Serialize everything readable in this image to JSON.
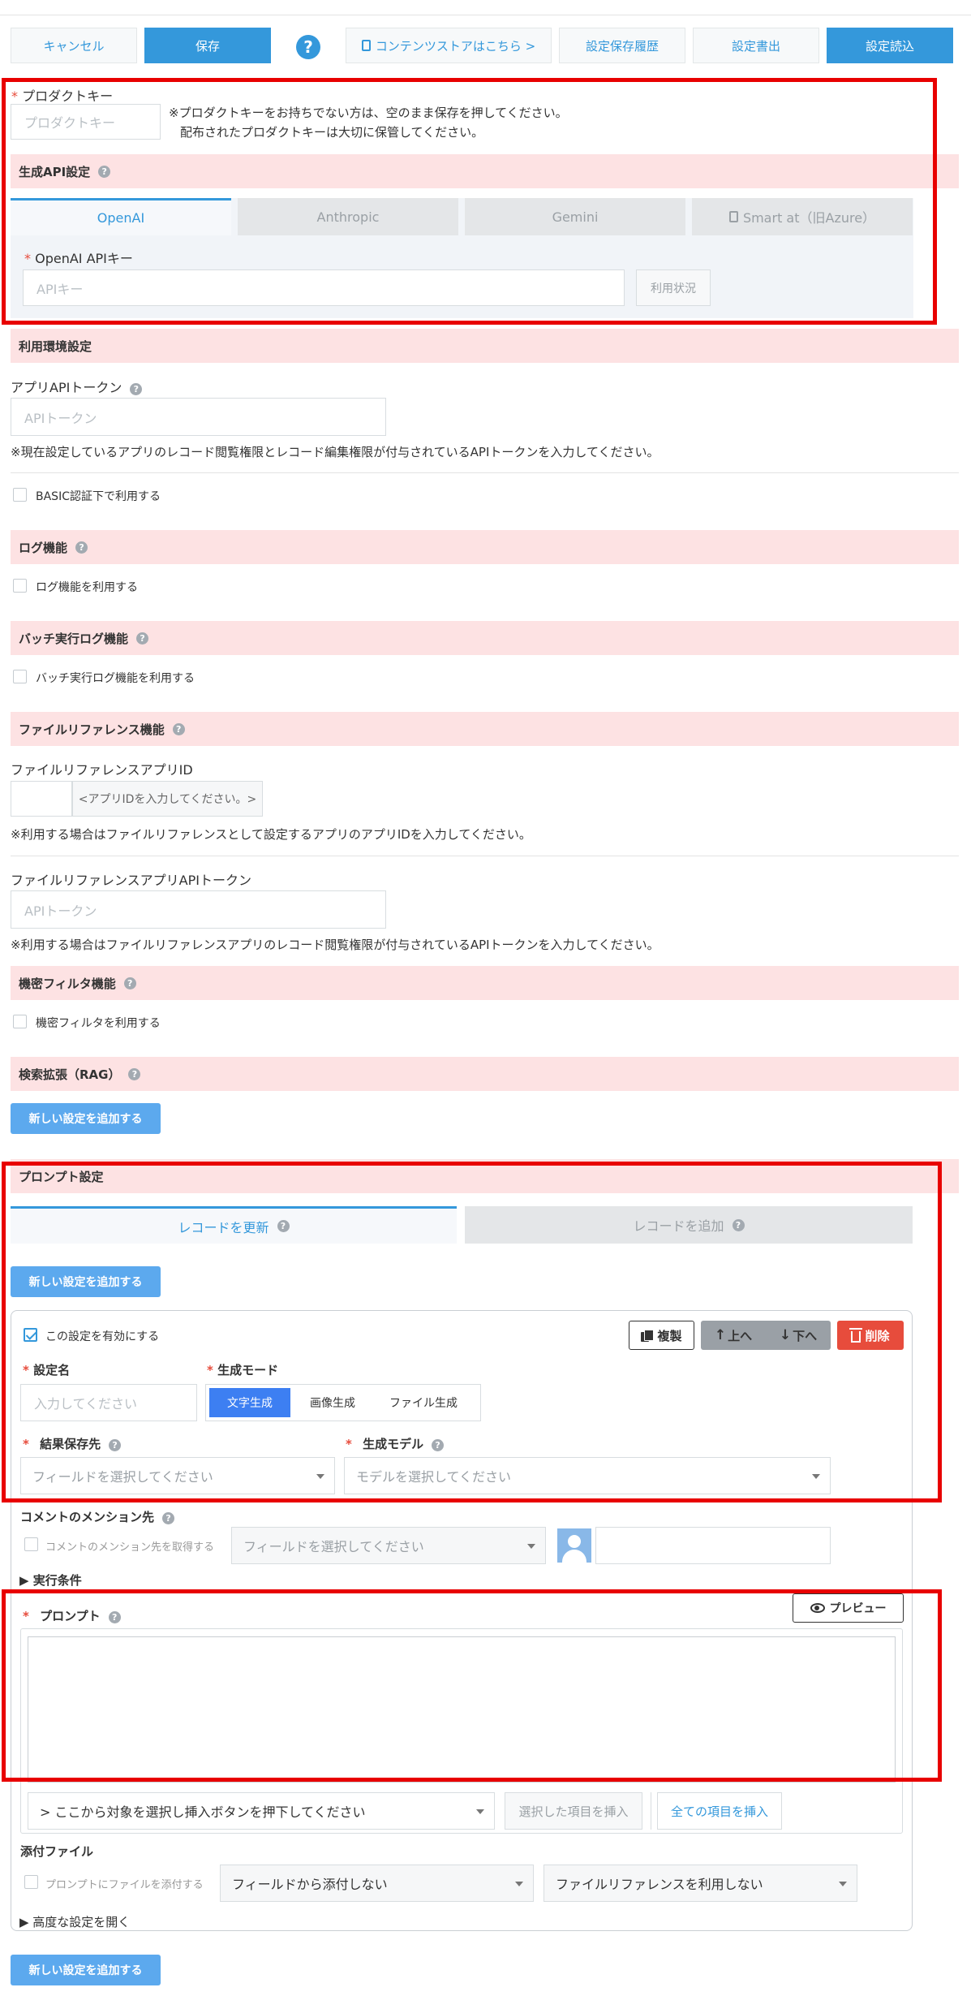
{
  "toolbar": {
    "cancel": "キャンセル",
    "save": "保存",
    "help": "?",
    "store_link": "コンテンツストアはこちら >",
    "history": "設定保存履歴",
    "export": "設定書出",
    "import": "設定読込"
  },
  "product_key": {
    "label": "プロダクトキー",
    "placeholder": "プロダクトキー",
    "note1": "※プロダクトキーをお持ちでない方は、空のまま保存を押してください。",
    "note2": "配布されたプロダクトキーは大切に保管してください。"
  },
  "gen_api": {
    "title": "生成API設定",
    "tabs": [
      "OpenAI",
      "Anthropic",
      "Gemini",
      "Smart at（旧Azure）"
    ],
    "key_label": "OpenAI APIキー",
    "key_placeholder": "APIキー",
    "usage_button": "利用状況"
  },
  "env": {
    "title": "利用環境設定",
    "token_label": "アプリAPIトークン",
    "token_placeholder": "APIトークン",
    "token_note": "※現在設定しているアプリのレコード閲覧権限とレコード編集権限が付与されているAPIトークンを入力してください。",
    "basic_auth": "BASIC認証下で利用する"
  },
  "log": {
    "title": "ログ機能",
    "checkbox": "ログ機能を利用する"
  },
  "batch_log": {
    "title": "バッチ実行ログ機能",
    "checkbox": "バッチ実行ログ機能を利用する"
  },
  "file_ref": {
    "title": "ファイルリファレンス機能",
    "app_id_label": "ファイルリファレンスアプリID",
    "app_id_hint": "<アプリIDを入力してください。>",
    "app_id_note": "※利用する場合はファイルリファレンスとして設定するアプリのアプリIDを入力してください。",
    "token_label": "ファイルリファレンスアプリAPIトークン",
    "token_placeholder": "APIトークン",
    "token_note": "※利用する場合はファイルリファレンスアプリのレコード閲覧権限が付与されているAPIトークンを入力してください。"
  },
  "secret": {
    "title": "機密フィルタ機能",
    "checkbox": "機密フィルタを利用する"
  },
  "rag": {
    "title": "検索拡張（RAG）",
    "add_button": "新しい設定を追加する"
  },
  "prompt": {
    "title": "プロンプト設定",
    "tabs": [
      "レコードを更新",
      "レコードを追加"
    ],
    "add_button": "新しい設定を追加する",
    "enable_checkbox": "この設定を有効にする",
    "copy_button": "複製",
    "up_button": "上へ",
    "down_button": "下へ",
    "delete_button": "削除",
    "name_label": "設定名",
    "name_placeholder": "入力してください",
    "mode_label": "生成モード",
    "modes": [
      "文字生成",
      "画像生成",
      "ファイル生成"
    ],
    "result_label": "結果保存先",
    "result_placeholder": "フィールドを選択してください",
    "model_label": "生成モデル",
    "model_placeholder": "モデルを選択してください",
    "mention_label": "コメントのメンション先",
    "mention_checkbox": "コメントのメンション先を取得する",
    "mention_placeholder": "フィールドを選択してください",
    "exec_condition": "▶ 実行条件",
    "prompt_label": "プロンプト",
    "preview_button": "プレビュー",
    "insert_select": "> ここから対象を選択し挿入ボタンを押下してください",
    "insert_selected": "選択した項目を挿入",
    "insert_all": "全ての項目を挿入",
    "attach_label": "添付ファイル",
    "attach_checkbox": "プロンプトにファイルを添付する",
    "attach_field": "フィールドから添付しない",
    "attach_ref": "ファイルリファレンスを利用しない",
    "advanced": "▶ 高度な設定を開く",
    "add_button_bottom": "新しい設定を追加する"
  },
  "colors": {
    "accent": "#3498db",
    "highlight": "#e80000",
    "section_bg": "#fde2e3",
    "delete": "#e74c3c"
  }
}
